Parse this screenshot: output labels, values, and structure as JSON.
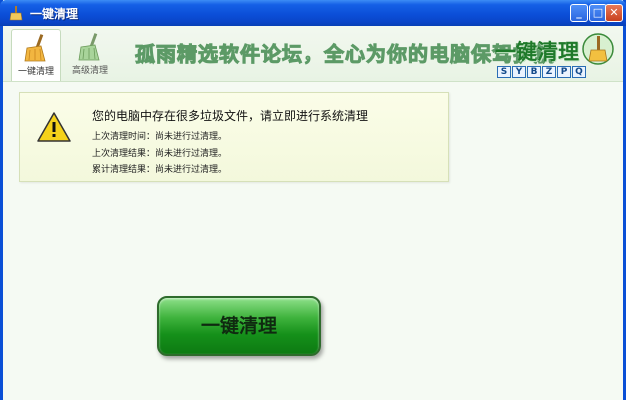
{
  "window": {
    "title": "一键清理"
  },
  "tabs": [
    {
      "label": "一键清理",
      "icon": "broom-icon",
      "active": true
    },
    {
      "label": "高级清理",
      "icon": "broom-icon",
      "active": false
    }
  ],
  "header": {
    "slogan": "孤雨精选软件论坛，全心为你的电脑保驾护航",
    "logo_text": "一键清理",
    "logo_letters": [
      "S",
      "Y",
      "B",
      "Z",
      "P",
      "Q"
    ]
  },
  "notice": {
    "heading": "您的电脑中存在很多垃圾文件，请立即进行系统清理",
    "last_time": "上次清理时间：尚未进行过清理。",
    "last_result": "上次清理结果：尚未进行过清理。",
    "total_result": "累计清理结果：尚未进行过清理。",
    "icon": "warning-icon"
  },
  "main": {
    "clean_button_label": "一键清理"
  },
  "colors": {
    "titlebar": "#0a4fd6",
    "accent_green": "#1f7a2a",
    "button_green": "#15901a"
  }
}
